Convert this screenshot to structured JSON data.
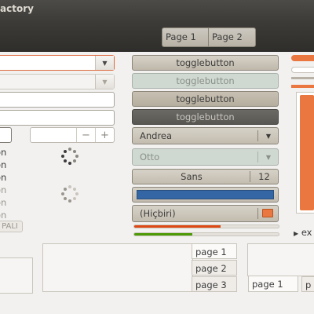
{
  "window": {
    "title": "actory"
  },
  "header": {
    "tabs": [
      "Page 1",
      "Page 2"
    ]
  },
  "left": {
    "spin_minus": "−",
    "spin_plus": "+",
    "row_labels": [
      "on",
      "on",
      "on",
      "on",
      "on",
      "on"
    ],
    "badge": "PALI"
  },
  "middle": {
    "toggle_buttons": [
      "togglebutton",
      "togglebutton",
      "togglebutton",
      "togglebutton"
    ],
    "combo_andrea": "Andrea",
    "combo_otto": "Otto",
    "font_name": "Sans",
    "font_size": "12",
    "file_chooser": "(Hiçbiri)",
    "progress": [
      0.6,
      0.4
    ]
  },
  "right": {
    "expander": "ex"
  },
  "notebooks": {
    "middle_tabs": [
      "page 1",
      "page 2",
      "page 3"
    ],
    "right_tabs": [
      "page 1",
      "p"
    ]
  },
  "colors": {
    "accent": "#dd4814",
    "selection": "#3465a4",
    "green": "#4e9a06",
    "header_bg": "#3c3b37"
  }
}
